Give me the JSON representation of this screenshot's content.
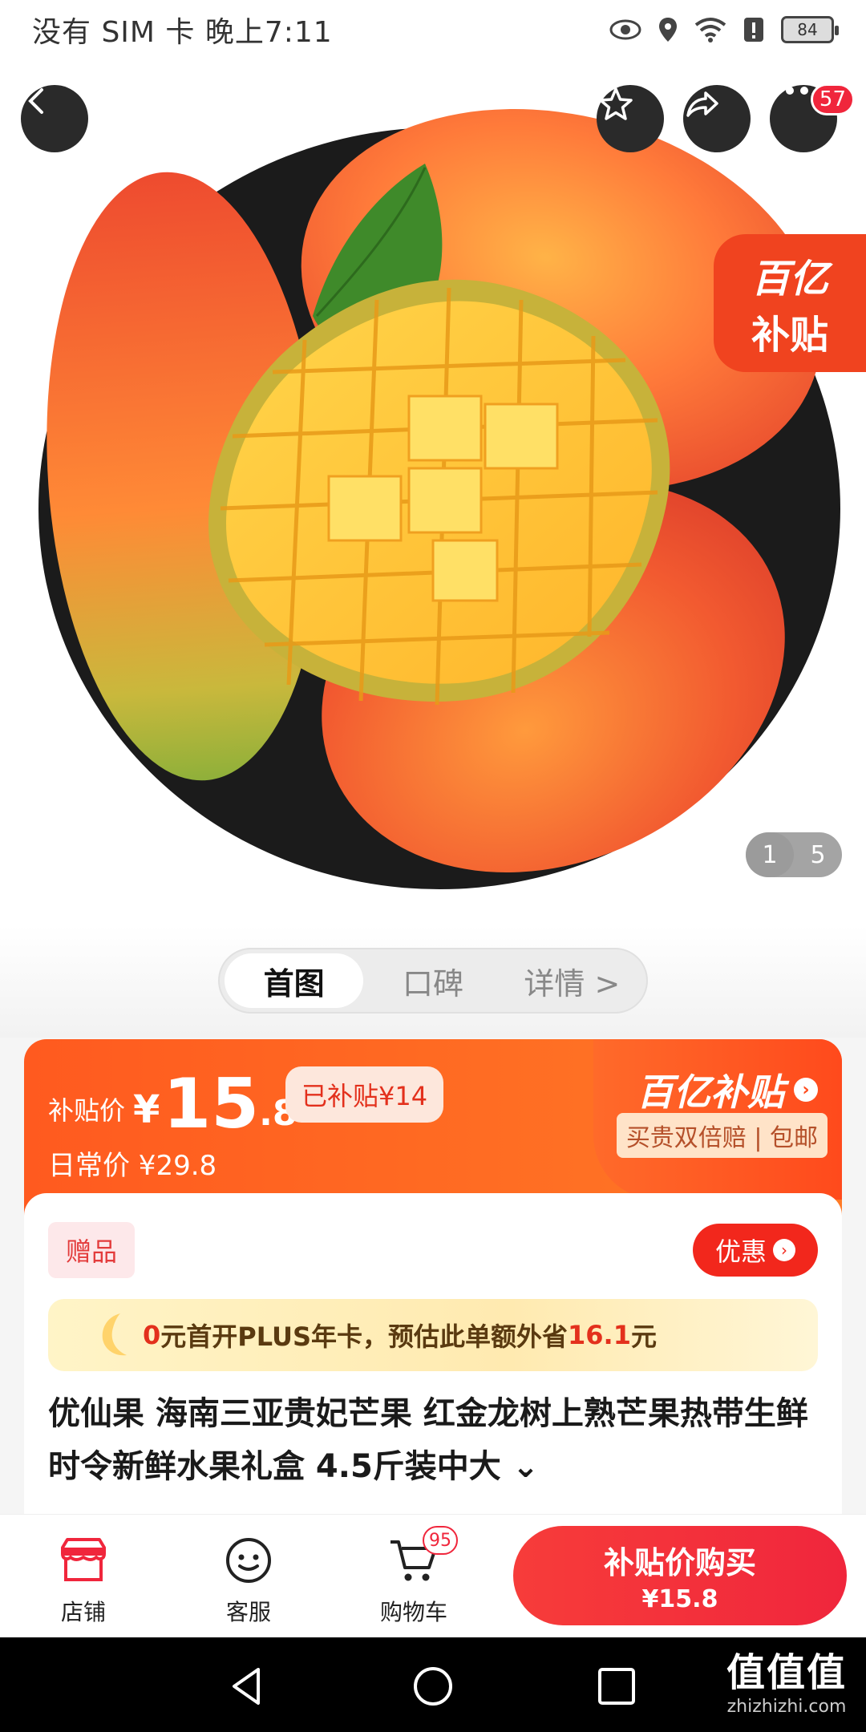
{
  "status_bar": {
    "carrier_time": "没有 SIM 卡 晚上7:11",
    "battery": "84"
  },
  "hero": {
    "more_badge": "57",
    "subsidy_corner": {
      "line1": "百亿",
      "line2": "补贴"
    },
    "counter": {
      "current": "1",
      "total": "5"
    }
  },
  "tabs": [
    "首图",
    "口碑",
    "详情 >"
  ],
  "price_card": {
    "label": "补贴价",
    "yen": "¥",
    "price_int": "15",
    "price_dec": ".8",
    "subsidized": "已补贴¥14",
    "daily_price": "日常价 ¥29.8",
    "brand_title": "百亿补贴",
    "brand_sub": "买贵双倍赔 | 包邮"
  },
  "info": {
    "gift": "赠品",
    "promo": "优惠",
    "plus_banner": {
      "part1": "0",
      "part2": "元首开PLUS年卡，预估此单额外省",
      "part3": "16.1",
      "part4": "元"
    },
    "title": "优仙果 海南三亚贵妃芒果 红金龙树上熟芒果热带生鲜时令新鲜水果礼盒 4.5斤装中大 ⌄"
  },
  "action_bar": {
    "store": "店铺",
    "service": "客服",
    "cart": "购物车",
    "cart_badge": "95",
    "buy_line1": "补贴价购买",
    "buy_line2": "¥15.8"
  },
  "watermark": {
    "logo": "值值值",
    "url": "zhizhizhi.com"
  },
  "colors": {
    "accent_red": "#f0263c",
    "subsidy_orange": "#ff5a1f"
  }
}
